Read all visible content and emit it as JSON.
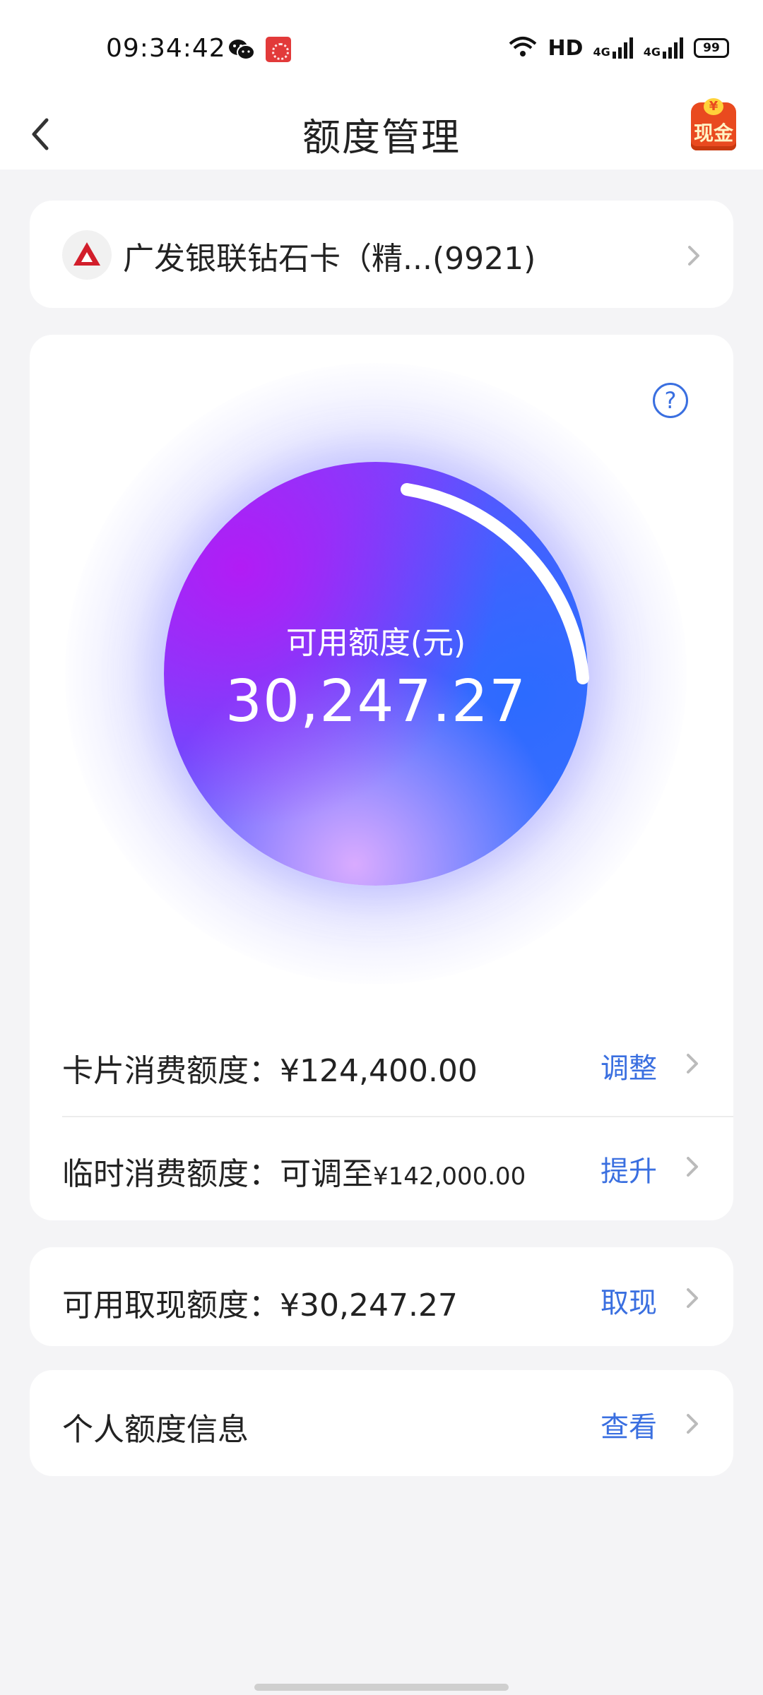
{
  "status_bar": {
    "time": "09:34:42",
    "network_hd": "HD",
    "signal_1": "4G",
    "signal_2": "4G",
    "battery": "99"
  },
  "header": {
    "title": "额度管理",
    "back_icon": "chevron-left-icon",
    "badge_coin": "¥",
    "badge_text": "现金"
  },
  "bank": {
    "name": "广发银联钻石卡（精...(9921)",
    "logo_color": "#d21e2b"
  },
  "available": {
    "label": "可用额度(元)",
    "value": "30,247.27"
  },
  "rows": {
    "card_limit": {
      "label": "卡片消费额度：",
      "value": "¥124,400.00",
      "action": "调整"
    },
    "temp_limit": {
      "label": "临时消费额度：可调至",
      "value": "¥142,000.00",
      "action": "提升"
    }
  },
  "cash": {
    "label": "可用取现额度：",
    "value": "¥30,247.27",
    "action": "取现"
  },
  "info": {
    "label": "个人额度信息",
    "action": "查看"
  },
  "colors": {
    "accent": "#3a6fe0",
    "background": "#f4f4f6",
    "orb_purple": "#b21cf5",
    "orb_blue": "#2c6bff"
  }
}
